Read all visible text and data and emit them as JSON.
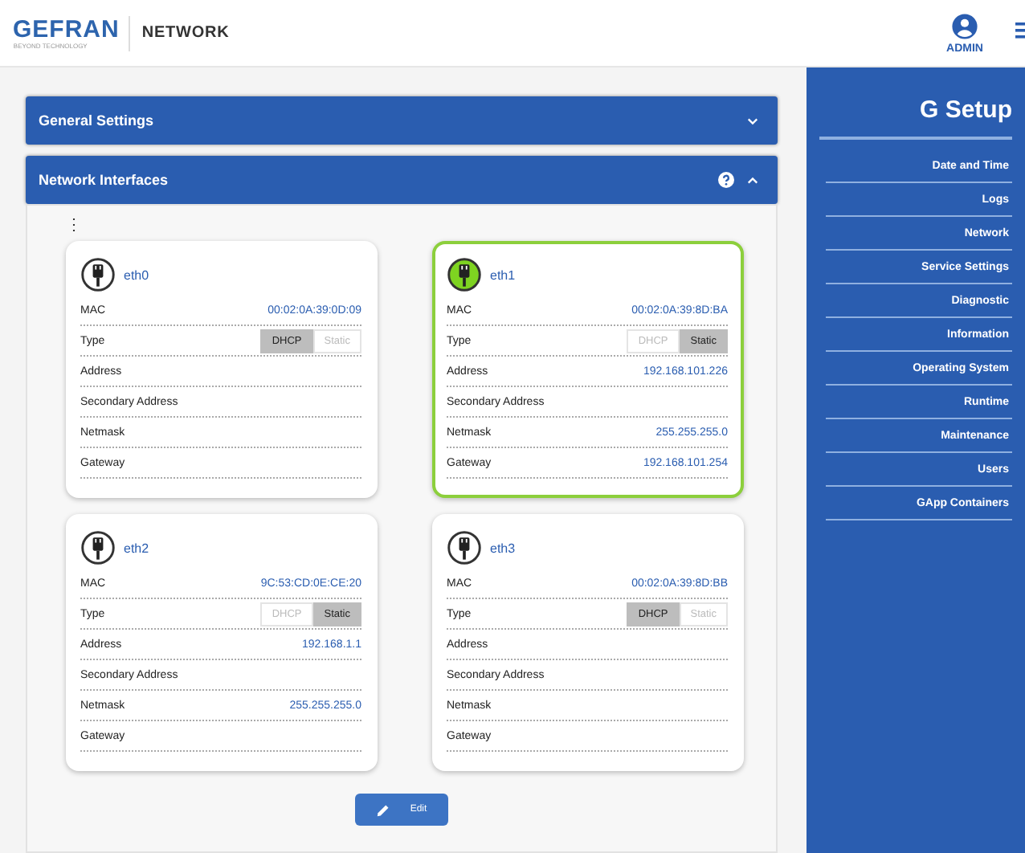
{
  "header": {
    "logo": "GEFRAN",
    "tagline": "BEYOND TECHNOLOGY",
    "page_title": "NETWORK",
    "user": "ADMIN"
  },
  "panels": [
    {
      "title": "General Settings",
      "expanded": false
    },
    {
      "title": "Network Interfaces",
      "expanded": true
    }
  ],
  "interfaces_menu": "⋮",
  "cards": [
    {
      "name": "eth0",
      "active": false,
      "fields": [
        {
          "kind": "text",
          "label": "MAC",
          "value": "00:02:0A:39:0D:09"
        },
        {
          "kind": "type",
          "label": "Type",
          "options": [
            {
              "label": "DHCP",
              "selected": true
            },
            {
              "label": "Static",
              "selected": false
            }
          ]
        },
        {
          "kind": "text",
          "label": "Address"
        },
        {
          "kind": "text",
          "label": "Secondary Address"
        },
        {
          "kind": "text",
          "label": "Netmask"
        },
        {
          "kind": "text",
          "label": "Gateway"
        }
      ]
    },
    {
      "name": "eth1",
      "active": true,
      "fields": [
        {
          "kind": "text",
          "label": "MAC",
          "value": "00:02:0A:39:8D:BA"
        },
        {
          "kind": "type",
          "label": "Type",
          "options": [
            {
              "label": "DHCP",
              "selected": false
            },
            {
              "label": "Static",
              "selected": true
            }
          ]
        },
        {
          "kind": "text",
          "label": "Address",
          "value": "192.168.101.226"
        },
        {
          "kind": "text",
          "label": "Secondary Address"
        },
        {
          "kind": "text",
          "label": "Netmask",
          "value": "255.255.255.0"
        },
        {
          "kind": "text",
          "label": "Gateway",
          "value": "192.168.101.254"
        }
      ]
    },
    {
      "name": "eth2",
      "active": false,
      "fields": [
        {
          "kind": "text",
          "label": "MAC",
          "value": "9C:53:CD:0E:CE:20"
        },
        {
          "kind": "type",
          "label": "Type",
          "options": [
            {
              "label": "DHCP",
              "selected": false
            },
            {
              "label": "Static",
              "selected": true
            }
          ]
        },
        {
          "kind": "text",
          "label": "Address",
          "value": "192.168.1.1"
        },
        {
          "kind": "text",
          "label": "Secondary Address"
        },
        {
          "kind": "text",
          "label": "Netmask",
          "value": "255.255.255.0"
        },
        {
          "kind": "text",
          "label": "Gateway"
        }
      ]
    },
    {
      "name": "eth3",
      "active": false,
      "fields": [
        {
          "kind": "text",
          "label": "MAC",
          "value": "00:02:0A:39:8D:BB"
        },
        {
          "kind": "type",
          "label": "Type",
          "options": [
            {
              "label": "DHCP",
              "selected": true
            },
            {
              "label": "Static",
              "selected": false
            }
          ]
        },
        {
          "kind": "text",
          "label": "Address"
        },
        {
          "kind": "text",
          "label": "Secondary Address"
        },
        {
          "kind": "text",
          "label": "Netmask"
        },
        {
          "kind": "text",
          "label": "Gateway"
        }
      ]
    }
  ],
  "edit_button": "Edit",
  "sidebar": {
    "title": "G Setup",
    "items": [
      "Date and Time",
      "Logs",
      "Network",
      "Service Settings",
      "Diagnostic",
      "Information",
      "Operating System",
      "Runtime",
      "Maintenance",
      "Users",
      "GApp Containers"
    ]
  }
}
